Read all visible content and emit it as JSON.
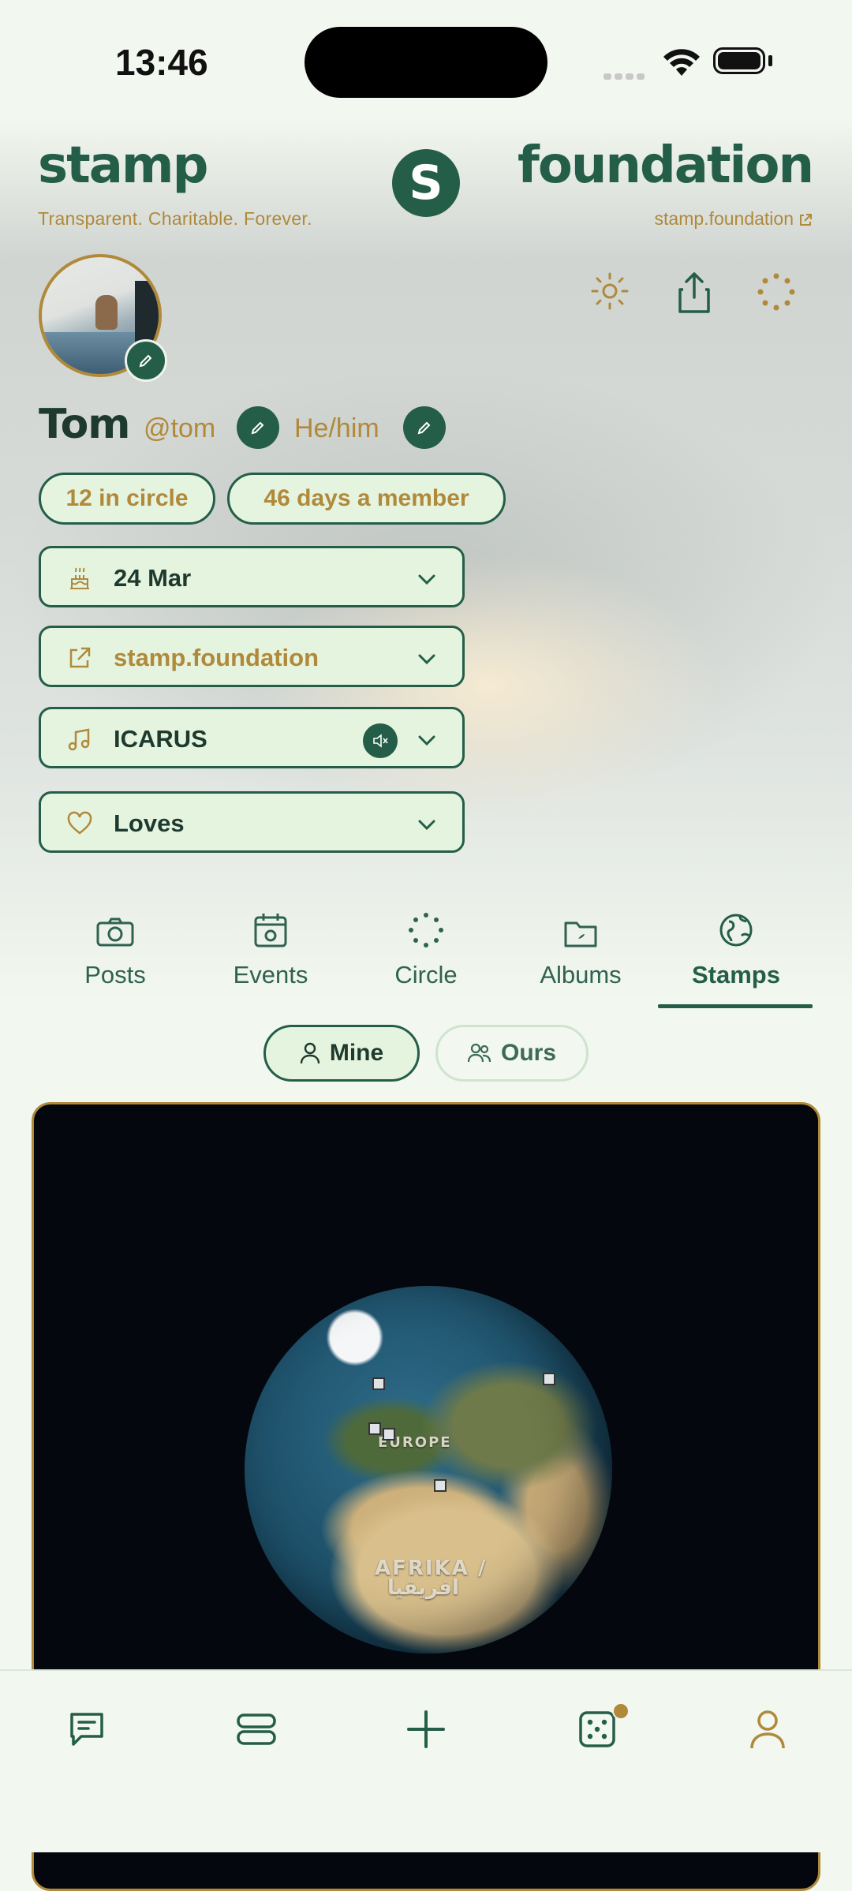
{
  "status": {
    "time": "13:46"
  },
  "brand": {
    "left_word": "stamp",
    "tagline": "Transparent. Charitable. Forever.",
    "logo_letter": "S",
    "right_word": "foundation",
    "site_link": "stamp.foundation"
  },
  "header_actions": [
    "sun-icon",
    "share-icon",
    "loading-icon"
  ],
  "profile": {
    "name": "Tom",
    "handle": "@tom",
    "pronouns": "He/him",
    "chips": [
      "12 in circle",
      "46 days a member"
    ],
    "rows": [
      {
        "icon": "cake-icon",
        "label": "24 Mar"
      },
      {
        "icon": "external-link-icon",
        "label": "stamp.foundation"
      },
      {
        "icon": "music-icon",
        "label": "ICARUS"
      },
      {
        "icon": "heart-icon",
        "label": "Loves"
      }
    ]
  },
  "tabs": [
    {
      "label": "Posts",
      "icon": "camera-icon"
    },
    {
      "label": "Events",
      "icon": "calendar-icon"
    },
    {
      "label": "Circle",
      "icon": "circle-dots-icon"
    },
    {
      "label": "Albums",
      "icon": "folder-icon"
    },
    {
      "label": "Stamps",
      "icon": "globe-icon",
      "active": true
    }
  ],
  "segments": {
    "mine": "Mine",
    "ours": "Ours",
    "selected": "Mine"
  },
  "globe": {
    "labels": [
      "EUROPE",
      "AFRIKA /",
      "افريقيا"
    ]
  },
  "bottom_nav": [
    "chat-icon",
    "stack-icon",
    "plus-icon",
    "dice-icon",
    "profile-icon"
  ],
  "colors": {
    "primary": "#245e48",
    "accent": "#b0893a",
    "chip_bg": "#e5f4df",
    "page_bg": "#f2f7ef"
  }
}
